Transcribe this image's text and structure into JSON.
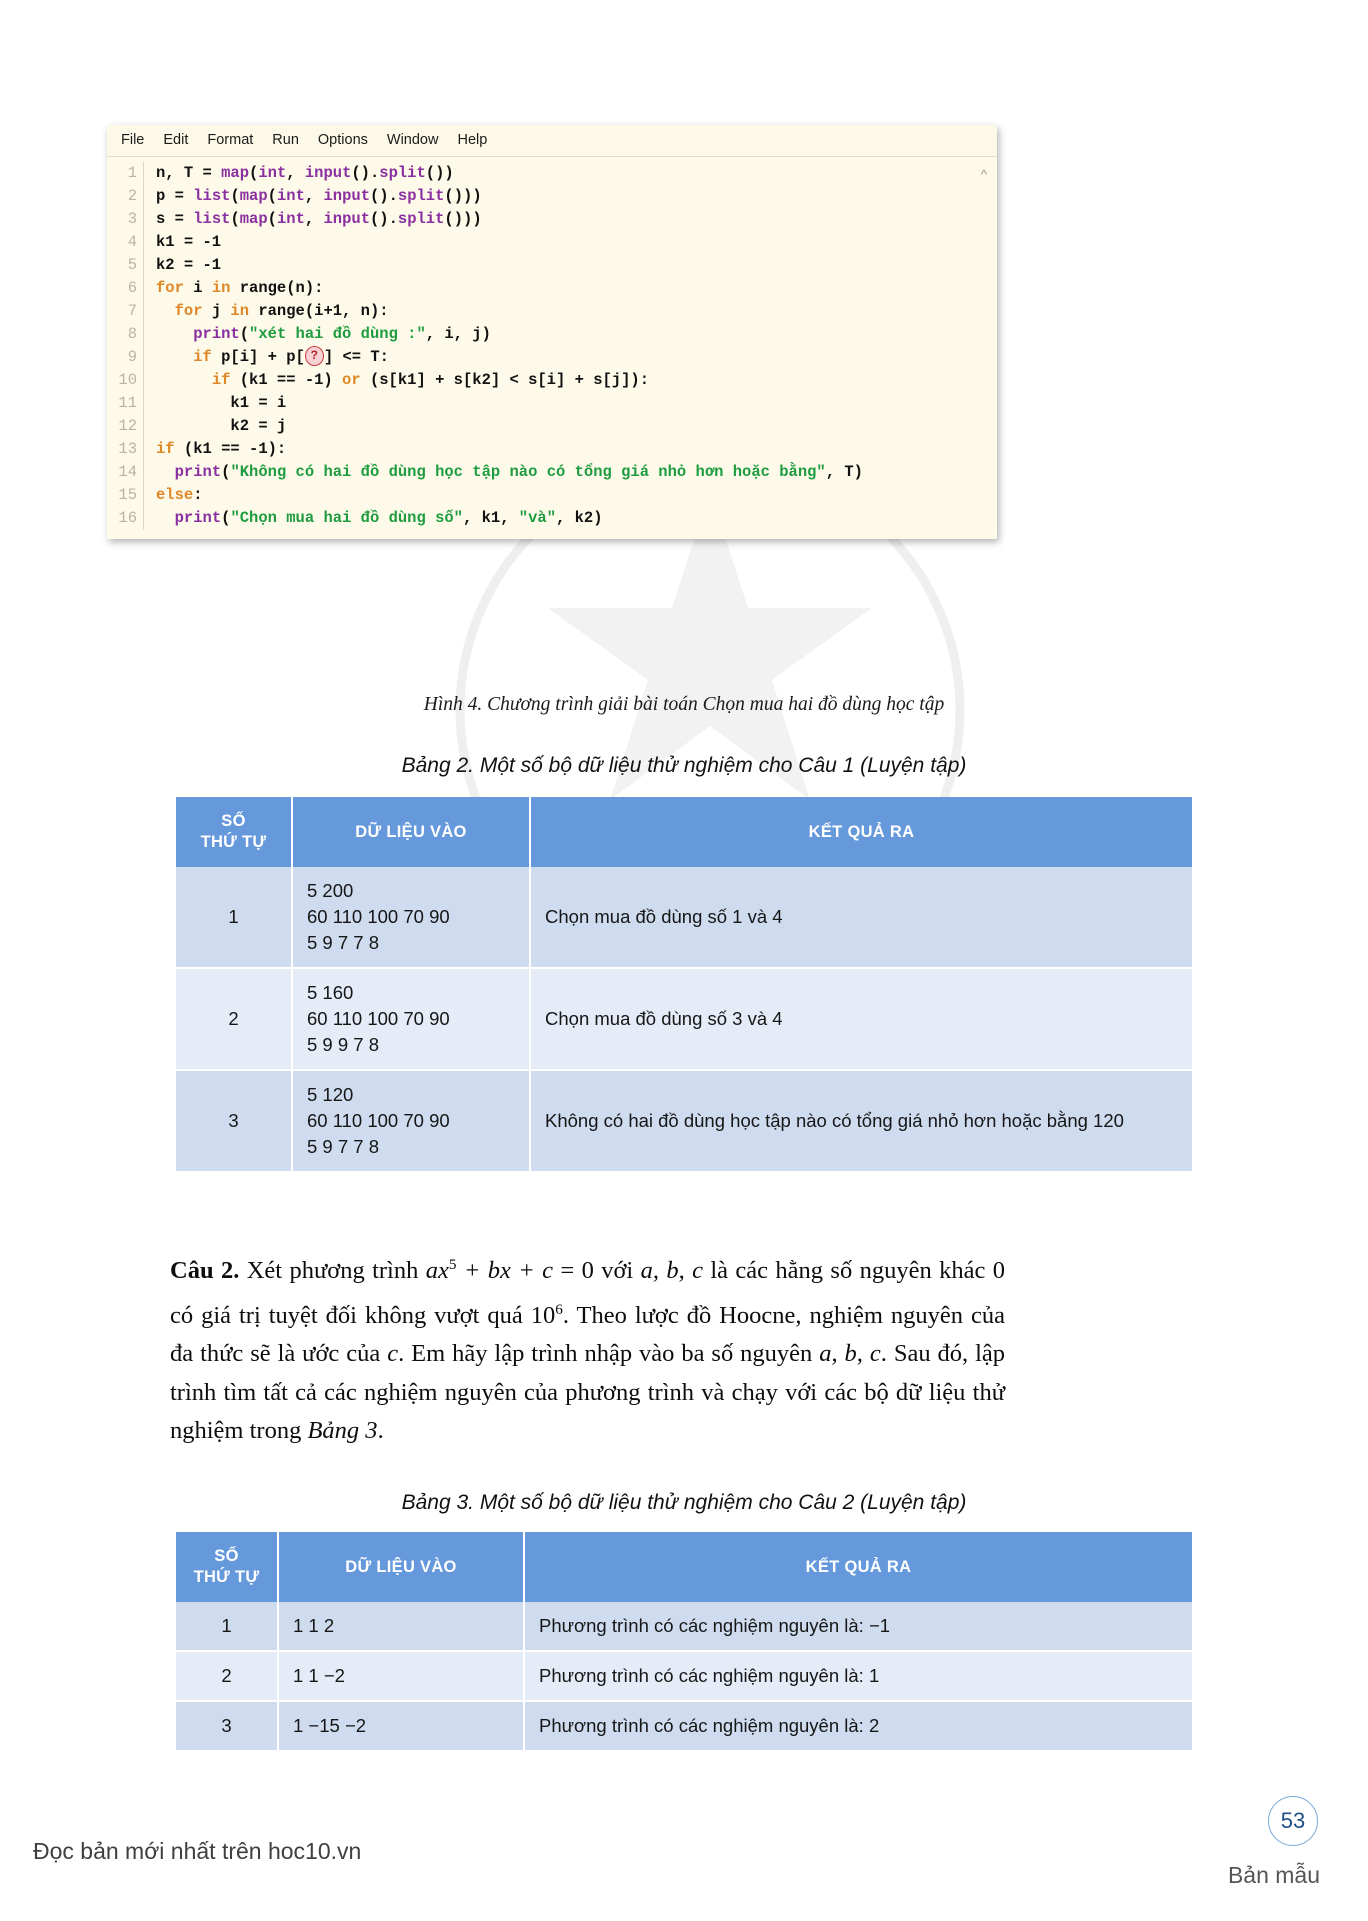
{
  "editor": {
    "menu": [
      "File",
      "Edit",
      "Format",
      "Run",
      "Options",
      "Window",
      "Help"
    ],
    "scroll_indicator": "^",
    "line_numbers": [
      "1",
      "2",
      "3",
      "4",
      "5",
      "6",
      "7",
      "8",
      "9",
      "10",
      "11",
      "12",
      "13",
      "14",
      "15",
      "16"
    ],
    "blank_marker": "?",
    "code_lines": [
      "n, T = map(int, input().split())",
      "p = list(map(int, input().split()))",
      "s = list(map(int, input().split()))",
      "k1 = -1",
      "k2 = -1",
      "for i in range(n):",
      "  for j in range(i+1, n):",
      "    print(\"xét hai đồ dùng :\", i, j)",
      "    if p[i] + p[?] <= T:",
      "      if (k1 == -1) or (s[k1] + s[k2] < s[i] + s[j]):",
      "        k1 = i",
      "        k2 = j",
      "if (k1 == -1):",
      "  print(\"Không có hai đồ dùng học tập nào có tổng giá nhỏ hơn hoặc bằng\", T)",
      "else:",
      "  print(\"Chọn mua hai đồ dùng số\", k1, \"và\", k2)"
    ]
  },
  "figure_caption": "Hình 4. Chương trình giải bài toán Chọn mua hai đồ dùng học tập",
  "table2": {
    "caption": "Bảng 2. Một số bộ dữ liệu thử nghiệm cho Câu 1 (Luyện tập)",
    "headers": [
      "SỐ\nTHỨ TỰ",
      "DỮ LIỆU VÀO",
      "KẾT QUẢ RA"
    ],
    "rows": [
      {
        "stt": "1",
        "input": "5 200\n60 110 100 70 90\n5 9 7 7 8",
        "output": "Chọn mua đồ dùng số 1 và 4"
      },
      {
        "stt": "2",
        "input": "5 160\n60 110 100 70 90\n5 9 9 7 8",
        "output": "Chọn mua đồ dùng số 3 và 4"
      },
      {
        "stt": "3",
        "input": "5 120\n60 110 100 70 90\n5 9 7 7 8",
        "output": "Không có hai đồ dùng học tập nào có tổng giá nhỏ hơn hoặc bằng 120"
      }
    ]
  },
  "question2": {
    "label": "Câu 2.",
    "text_part1": " Xét phương trình ",
    "eq_a": "ax",
    "eq_exp1": "5",
    "eq_mid": " + bx + c",
    "eq_end": " = 0 với ",
    "vars": "a, b, c",
    "text_part2": " là các hằng số nguyên khác 0 có giá trị tuyệt đối không vượt quá 10",
    "exp2": "6",
    "text_part3": ". Theo lược đồ Hoocne, nghiệm nguyên của đa thức sẽ là ước của ",
    "var_c": "c",
    "text_part4": ". Em hãy lập trình nhập vào ba số nguyên ",
    "vars2": "a, b, c",
    "text_part5": ". Sau đó, lập trình tìm tất cả các nghiệm nguyên của phương trình và chạy với các bộ dữ liệu thử nghiệm trong ",
    "ref": "Bảng 3",
    "text_part6": "."
  },
  "table3": {
    "caption": "Bảng 3. Một số bộ dữ liệu thử nghiệm cho Câu 2 (Luyện tập)",
    "headers": [
      "SỐ\nTHỨ TỰ",
      "DỮ LIỆU VÀO",
      "KẾT QUẢ RA"
    ],
    "rows": [
      {
        "stt": "1",
        "input": "1 1 2",
        "output": "Phương trình có các nghiệm nguyên là: −1"
      },
      {
        "stt": "2",
        "input": "1 1 −2",
        "output": "Phương trình có các nghiệm nguyên là: 1"
      },
      {
        "stt": "3",
        "input": "1 −15 −2",
        "output": "Phương trình có các nghiệm nguyên là: 2"
      }
    ]
  },
  "footer": {
    "left": "Đọc bản mới nhất trên hoc10.vn",
    "page_number": "53",
    "sample": "Bản mẫu"
  }
}
